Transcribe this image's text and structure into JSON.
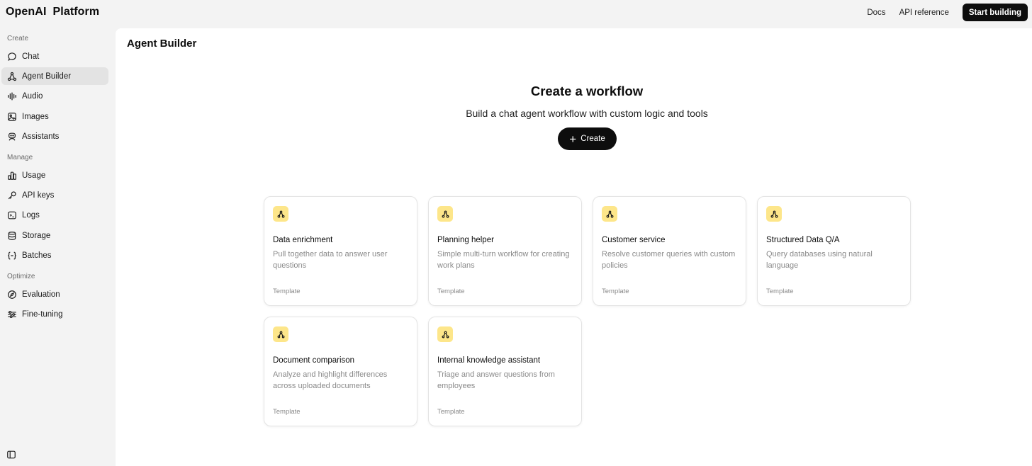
{
  "brand": {
    "word1": "OpenAI",
    "word2": "Platform"
  },
  "topnav": {
    "docs": "Docs",
    "api_reference": "API reference",
    "start_building": "Start building"
  },
  "sidebar": {
    "create_label": "Create",
    "manage_label": "Manage",
    "optimize_label": "Optimize",
    "items": {
      "chat": "Chat",
      "agent_builder": "Agent Builder",
      "audio": "Audio",
      "images": "Images",
      "assistants": "Assistants",
      "usage": "Usage",
      "api_keys": "API keys",
      "logs": "Logs",
      "storage": "Storage",
      "batches": "Batches",
      "evaluation": "Evaluation",
      "fine_tuning": "Fine-tuning"
    }
  },
  "main": {
    "page_title": "Agent Builder",
    "hero_title": "Create a workflow",
    "hero_subtitle": "Build a chat agent workflow with custom logic and tools",
    "create_button": "Create"
  },
  "templates": [
    {
      "title": "Data enrichment",
      "description": "Pull together data to answer user questions",
      "tag": "Template"
    },
    {
      "title": "Planning helper",
      "description": "Simple multi-turn workflow for creating work plans",
      "tag": "Template"
    },
    {
      "title": "Customer service",
      "description": "Resolve customer queries with custom policies",
      "tag": "Template"
    },
    {
      "title": "Structured Data Q/A",
      "description": "Query databases using natural language",
      "tag": "Template"
    },
    {
      "title": "Document comparison",
      "description": "Analyze and highlight differences across uploaded documents",
      "tag": "Template"
    },
    {
      "title": "Internal knowledge assistant",
      "description": "Triage and answer questions from employees",
      "tag": "Template"
    }
  ],
  "colors": {
    "accent_badge": "#fde68a",
    "primary": "#0d0d0d",
    "sidebar_bg": "#f3f3f3"
  }
}
